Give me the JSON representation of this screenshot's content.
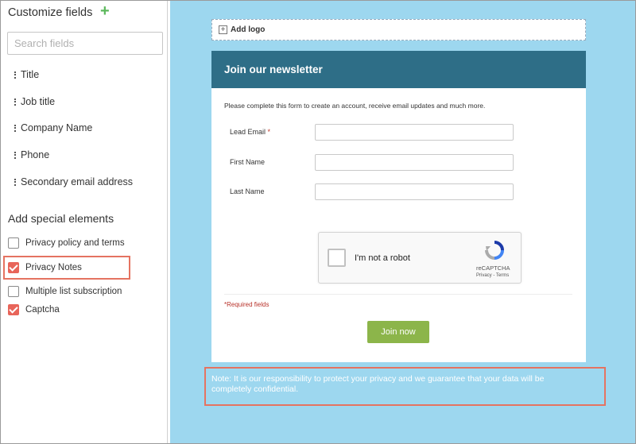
{
  "sidebar": {
    "title": "Customize fields",
    "add_icon": "plus-icon",
    "search_placeholder": "Search fields",
    "fields": [
      "Title",
      "Job title",
      "Company Name",
      "Phone",
      "Secondary email address"
    ],
    "special_title": "Add special elements",
    "special_elements": [
      {
        "label": "Privacy policy and terms",
        "checked": false
      },
      {
        "label": "Privacy Notes",
        "checked": true
      },
      {
        "label": "Multiple list subscription",
        "checked": false
      },
      {
        "label": "Captcha",
        "checked": true
      }
    ]
  },
  "canvas": {
    "add_logo": "Add logo",
    "form": {
      "title": "Join our newsletter",
      "intro": "Please complete this form to create an account, receive email updates and much more.",
      "fields": [
        {
          "label": "Lead Email",
          "required_mark": "*"
        },
        {
          "label": "First Name"
        },
        {
          "label": "Last Name"
        }
      ],
      "captcha": {
        "label": "I'm not a robot",
        "brand": "reCAPTCHA",
        "terms": "Privacy - Terms"
      },
      "required_note": "*Required fields",
      "submit_label": "Join now"
    },
    "privacy_note": "Note: It is our responsibility to protect your privacy and we guarantee that your data will be completely confidential."
  },
  "colors": {
    "header": "#2e6e87",
    "canvas_bg": "#9dd7ef",
    "checkbox_checked": "#e8655a",
    "button": "#8cb54a",
    "highlight": "#e57361"
  }
}
